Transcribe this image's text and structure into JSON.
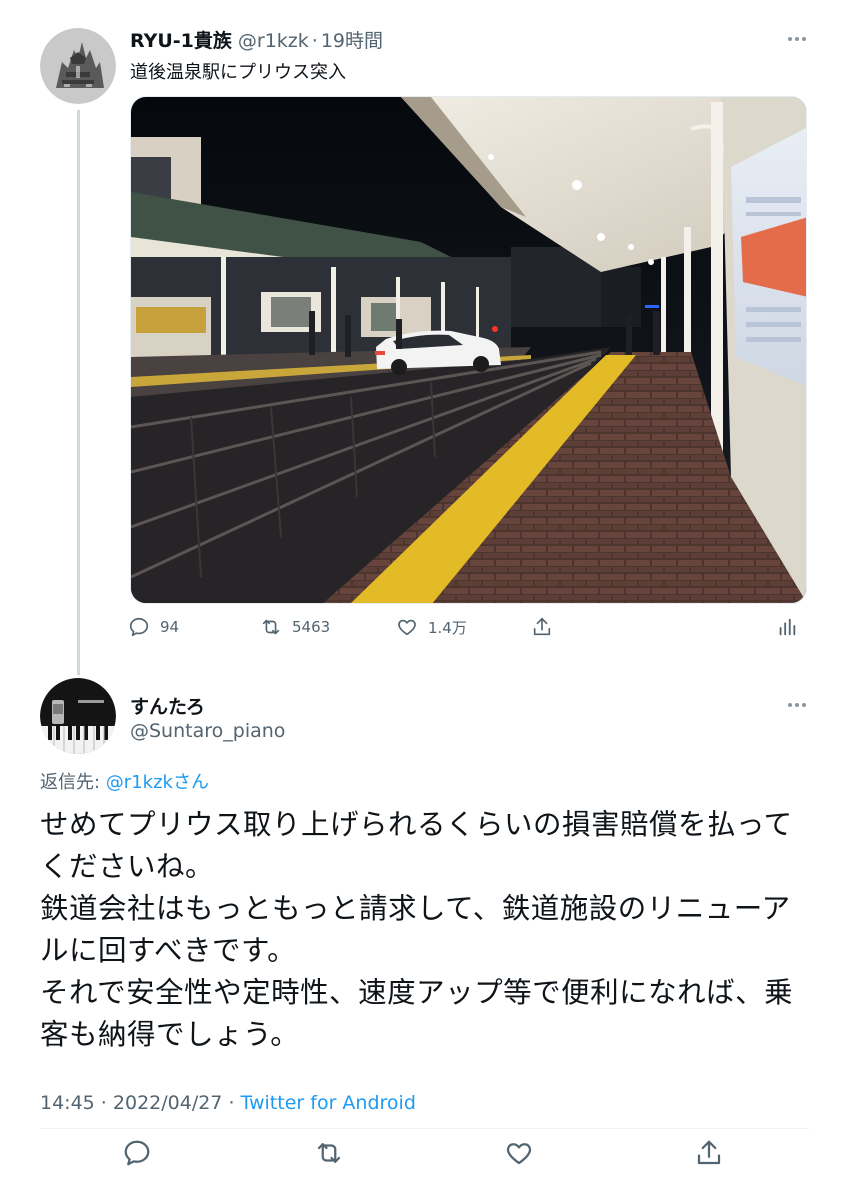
{
  "colors": {
    "text_primary": "#0f1419",
    "text_secondary": "#536471",
    "link": "#1d9bf0",
    "thread_line": "#cfd9de"
  },
  "parent_tweet": {
    "display_name": "RYU-1貴族",
    "handle": "@r1kzk",
    "dot": "·",
    "time": "19時間",
    "text": "道後温泉駅にプリウス突入",
    "media_description_icon": "photo",
    "stats": {
      "replies": "94",
      "retweets": "5463",
      "likes": "1.4万"
    }
  },
  "reply_tweet": {
    "display_name": "すんたろ",
    "handle": "@Suntaro_piano",
    "reply_prefix": "返信先: ",
    "reply_mention": "@r1kzk",
    "reply_suffix": "さん",
    "text_lines": [
      "せめてプリウス取り上げられるくらいの損害賠償を払って",
      "くださいね。",
      "鉄道会社はもっともっと請求して、鉄道施設のリニューア",
      "ルに回すべきです。",
      "それで安全性や定時性、速度アップ等で便利になれば、乗",
      "客も納得でしょう。"
    ],
    "time": "14:45",
    "date": "2022/04/27",
    "separator": " · ",
    "source": "Twitter for Android"
  }
}
